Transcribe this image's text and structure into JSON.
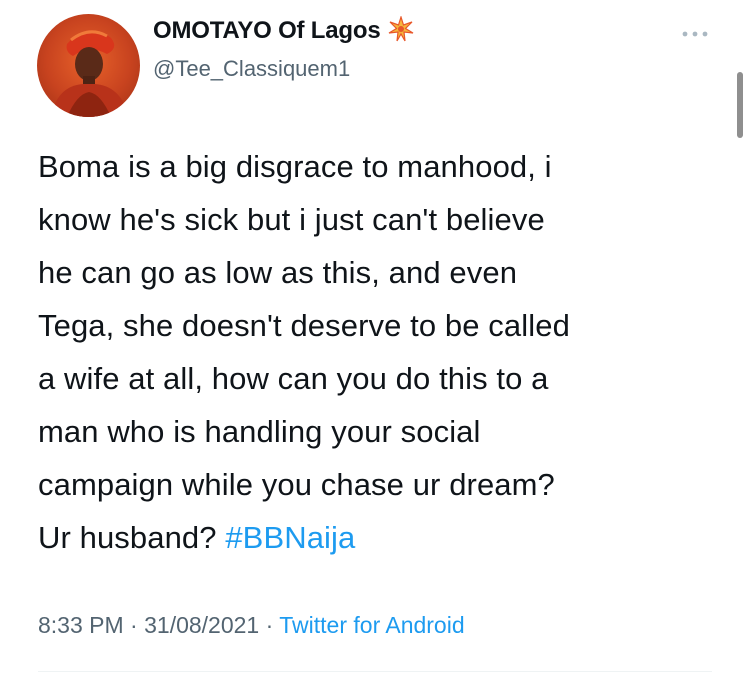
{
  "author": {
    "display_name": "OMOTAYO Of Lagos",
    "name_emoji": "collision-sparkle-icon",
    "handle": "@Tee_Classiquem1"
  },
  "tweet": {
    "lines": [
      "Boma is a big disgrace to manhood, i",
      "know he's sick but i just can't believe",
      "he can go as low as this, and even",
      "Tega, she doesn't deserve to be called",
      "a wife at all, how can you do this to a",
      "man who is handling your social",
      "campaign while you chase ur dream?"
    ],
    "last_line_text": "Ur husband? ",
    "hashtag": "#BBNaija"
  },
  "meta": {
    "time": "8:33 PM",
    "separator": " · ",
    "date": "31/08/2021",
    "source": "Twitter for Android"
  },
  "colors": {
    "text": "#0f1419",
    "secondary": "#536471",
    "link": "#1d9bf0",
    "avatar_bg": "#c8431f"
  },
  "icons": {
    "more": "more-dots-icon"
  }
}
